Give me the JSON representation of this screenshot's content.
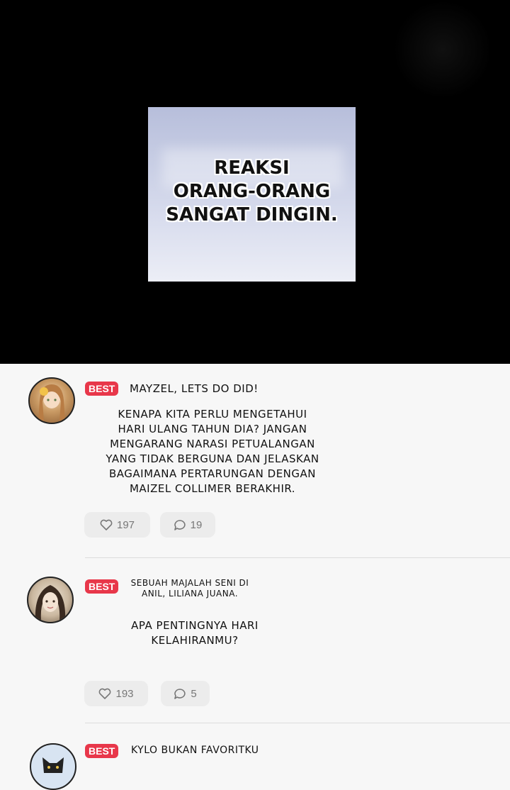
{
  "panel": {
    "lines": [
      "REAKSI",
      "ORANG-ORANG",
      "SANGAT DINGIN."
    ]
  },
  "comments": [
    {
      "badge": "BEST",
      "author": "MAYZEL, LETS DO DID!",
      "lines": [
        "KENAPA KITA PERLU MENGETAHUI",
        "HARI ULANG TAHUN DIA? JANGAN",
        "MENGARANG NARASI PETUALANGAN",
        "YANG TIDAK BERGUNA DAN JELASKAN",
        "BAGAIMANA PERTARUNGAN DENGAN",
        "MAIZEL COLLIMER BERAKHIR."
      ],
      "likes": "197",
      "replies": "19"
    },
    {
      "badge": "BEST",
      "author_lines": [
        "SEBUAH MAJALAH SENI DI",
        "ANIL, LILIANA JUANA."
      ],
      "lines": [
        "APA PENTINGNYA HARI",
        "KELAHIRANMU?"
      ],
      "likes": "193",
      "replies": "5"
    },
    {
      "badge": "BEST",
      "author": "KYLO BUKAN FAVORITKU"
    }
  ],
  "colors": {
    "badge": "#e8374a",
    "pill": "#ececec",
    "background": "#f7f7f7"
  }
}
